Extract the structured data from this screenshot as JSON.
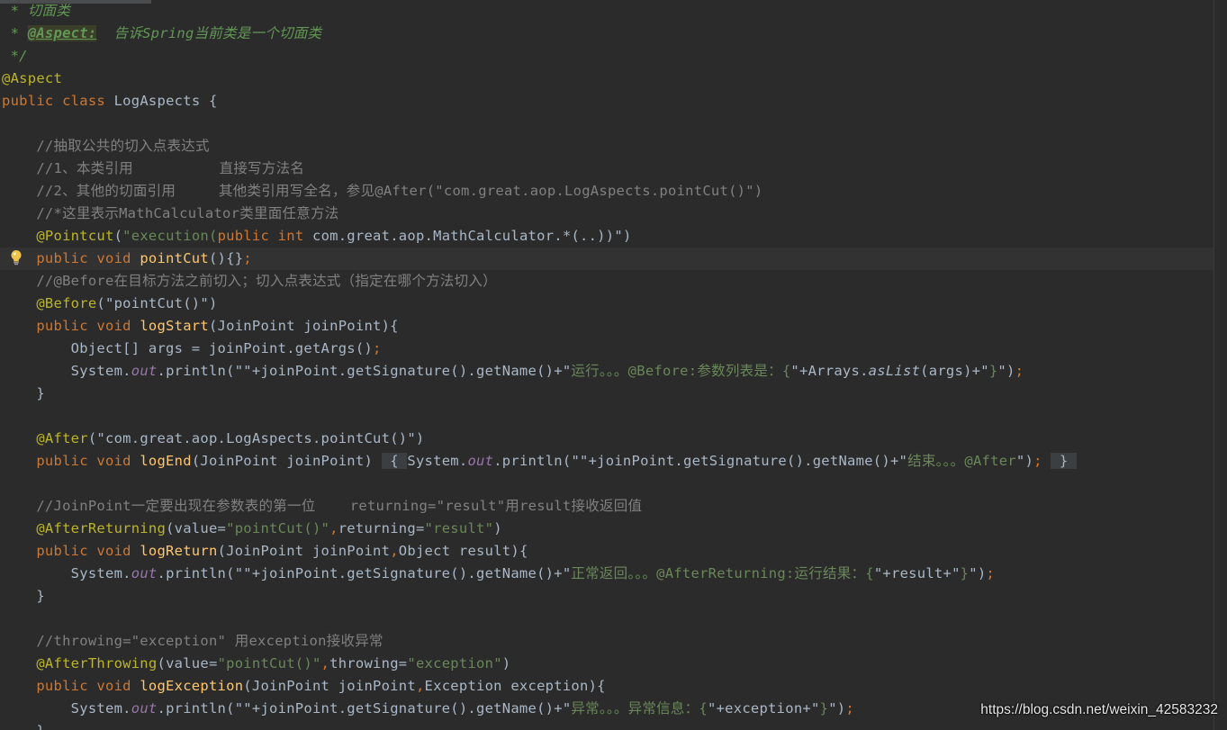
{
  "editor": {
    "lines": [
      [
        {
          "t": " * 切面类",
          "c": "doc"
        }
      ],
      [
        {
          "t": " * ",
          "c": "doc"
        },
        {
          "t": "@Aspect:",
          "c": "doctag"
        },
        {
          "t": "  告诉Spring当前类是一个切面类",
          "c": "doc"
        }
      ],
      [
        {
          "t": " */",
          "c": "doc"
        }
      ],
      [
        {
          "t": "@Aspect",
          "c": "ann"
        }
      ],
      [
        {
          "t": "public class ",
          "c": "key"
        },
        {
          "t": "LogAspects {",
          "c": ""
        }
      ],
      [],
      [
        {
          "t": "    //抽取公共的切入点表达式",
          "c": "com"
        }
      ],
      [
        {
          "t": "    //1、本类引用          直接写方法名",
          "c": "com"
        }
      ],
      [
        {
          "t": "    //2、其他的切面引用     其他类引用写全名，参见@After(\"com.great.aop.LogAspects.pointCut()\")",
          "c": "com"
        }
      ],
      [
        {
          "t": "    //*这里表示MathCalculator类里面任意方法",
          "c": "com"
        }
      ],
      [
        {
          "t": "    ",
          "c": ""
        },
        {
          "t": "@Pointcut",
          "c": "ann"
        },
        {
          "t": "(",
          "c": ""
        },
        {
          "t": "\"execution(",
          "c": "str"
        },
        {
          "t": "public int ",
          "c": "key"
        },
        {
          "t": "com.great.aop.MathCalculator.*(..))\"",
          "c": ""
        },
        {
          "t": ")",
          "c": ""
        }
      ],
      [
        {
          "t": "    ",
          "c": ""
        },
        {
          "t": "public void ",
          "c": "key"
        },
        {
          "t": "pointCut",
          "c": "fn"
        },
        {
          "t": "(){}",
          "c": ""
        },
        {
          "t": ";",
          "c": "punc"
        }
      ],
      [
        {
          "t": "    //@Before在目标方法之前切入；切入点表达式（指定在哪个方法切入）",
          "c": "com"
        }
      ],
      [
        {
          "t": "    ",
          "c": ""
        },
        {
          "t": "@Before",
          "c": "ann"
        },
        {
          "t": "(\"pointCut()\")",
          "c": ""
        }
      ],
      [
        {
          "t": "    ",
          "c": ""
        },
        {
          "t": "public void ",
          "c": "key"
        },
        {
          "t": "logStart",
          "c": "fn"
        },
        {
          "t": "(JoinPoint joinPoint){",
          "c": ""
        }
      ],
      [
        {
          "t": "        Object[] args = joinPoint.getArgs()",
          "c": ""
        },
        {
          "t": ";",
          "c": "punc"
        }
      ],
      [
        {
          "t": "        System.",
          "c": ""
        },
        {
          "t": "out",
          "c": "it"
        },
        {
          "t": ".println(\"\"+joinPoint.getSignature().getName()+\"",
          "c": ""
        },
        {
          "t": "运行。。。@Before:参数列表是：{",
          "c": "str"
        },
        {
          "t": "\"+Arrays.",
          "c": ""
        },
        {
          "t": "asList",
          "c": "sit"
        },
        {
          "t": "(args)+\"",
          "c": ""
        },
        {
          "t": "}",
          "c": "str"
        },
        {
          "t": "\")",
          "c": ""
        },
        {
          "t": ";",
          "c": "punc"
        }
      ],
      [
        {
          "t": "    }",
          "c": ""
        }
      ],
      [],
      [
        {
          "t": "    ",
          "c": ""
        },
        {
          "t": "@After",
          "c": "ann"
        },
        {
          "t": "(\"com.great.aop.LogAspects.pointCut()\")",
          "c": ""
        }
      ],
      [
        {
          "t": "    ",
          "c": ""
        },
        {
          "t": "public void ",
          "c": "key"
        },
        {
          "t": "logEnd",
          "c": "fn"
        },
        {
          "t": "(JoinPoint joinPoint) ",
          "c": ""
        },
        {
          "t": " { ",
          "c": "fold"
        },
        {
          "t": "System.",
          "c": ""
        },
        {
          "t": "out",
          "c": "it"
        },
        {
          "t": ".println(\"\"+joinPoint.getSignature().getName()+\"",
          "c": ""
        },
        {
          "t": "结束。。。@After",
          "c": "str"
        },
        {
          "t": "\")",
          "c": ""
        },
        {
          "t": ";",
          "c": "punc"
        },
        {
          "t": " ",
          "c": ""
        },
        {
          "t": " } ",
          "c": "fold"
        }
      ],
      [],
      [
        {
          "t": "    //JoinPoint一定要出现在参数表的第一位    returning=\"result\"用result接收返回值",
          "c": "com"
        }
      ],
      [
        {
          "t": "    ",
          "c": ""
        },
        {
          "t": "@AfterReturning",
          "c": "ann"
        },
        {
          "t": "(value=",
          "c": ""
        },
        {
          "t": "\"pointCut()\"",
          "c": "str"
        },
        {
          "t": ",",
          "c": "punc"
        },
        {
          "t": "returning=",
          "c": ""
        },
        {
          "t": "\"result\"",
          "c": "str"
        },
        {
          "t": ")",
          "c": ""
        }
      ],
      [
        {
          "t": "    ",
          "c": ""
        },
        {
          "t": "public void ",
          "c": "key"
        },
        {
          "t": "logReturn",
          "c": "fn"
        },
        {
          "t": "(JoinPoint joinPoint",
          "c": ""
        },
        {
          "t": ",",
          "c": "punc"
        },
        {
          "t": "Object result){",
          "c": ""
        }
      ],
      [
        {
          "t": "        System.",
          "c": ""
        },
        {
          "t": "out",
          "c": "it"
        },
        {
          "t": ".println(\"\"+joinPoint.getSignature().getName()+\"",
          "c": ""
        },
        {
          "t": "正常返回。。。@AfterReturning:运行结果：{",
          "c": "str"
        },
        {
          "t": "\"+result+\"",
          "c": ""
        },
        {
          "t": "}",
          "c": "str"
        },
        {
          "t": "\")",
          "c": ""
        },
        {
          "t": ";",
          "c": "punc"
        }
      ],
      [
        {
          "t": "    }",
          "c": ""
        }
      ],
      [],
      [
        {
          "t": "    //throwing=\"exception\" 用exception接收异常",
          "c": "com"
        }
      ],
      [
        {
          "t": "    ",
          "c": ""
        },
        {
          "t": "@AfterThrowing",
          "c": "ann"
        },
        {
          "t": "(value=",
          "c": ""
        },
        {
          "t": "\"pointCut()\"",
          "c": "str"
        },
        {
          "t": ",",
          "c": "punc"
        },
        {
          "t": "throwing=",
          "c": ""
        },
        {
          "t": "\"exception\"",
          "c": "str"
        },
        {
          "t": ")",
          "c": ""
        }
      ],
      [
        {
          "t": "    ",
          "c": ""
        },
        {
          "t": "public void ",
          "c": "key"
        },
        {
          "t": "logException",
          "c": "fn"
        },
        {
          "t": "(JoinPoint joinPoint",
          "c": ""
        },
        {
          "t": ",",
          "c": "punc"
        },
        {
          "t": "Exception exception){",
          "c": ""
        }
      ],
      [
        {
          "t": "        System.",
          "c": ""
        },
        {
          "t": "out",
          "c": "it"
        },
        {
          "t": ".println(\"\"+joinPoint.getSignature().getName()+\"",
          "c": ""
        },
        {
          "t": "异常。。。异常信息：{",
          "c": "str"
        },
        {
          "t": "\"+exception+\"",
          "c": ""
        },
        {
          "t": "}",
          "c": "str"
        },
        {
          "t": "\")",
          "c": ""
        },
        {
          "t": ";",
          "c": "punc"
        }
      ],
      [
        {
          "t": "    }",
          "c": ""
        }
      ]
    ],
    "current_line": 11,
    "intention_icon": "lightbulb-icon"
  },
  "watermark": {
    "text": "https://blog.csdn.net/weixin_42583232"
  },
  "colors": {
    "background": "#2b2b2b",
    "current_line": "#323232",
    "keyword": "#cc7832",
    "annotation": "#bbb529",
    "string": "#6a8759",
    "comment": "#808080",
    "doc_comment": "#629755",
    "method_declaration": "#ffc66d",
    "static_field": "#9876aa",
    "default_text": "#a9b7c6"
  }
}
